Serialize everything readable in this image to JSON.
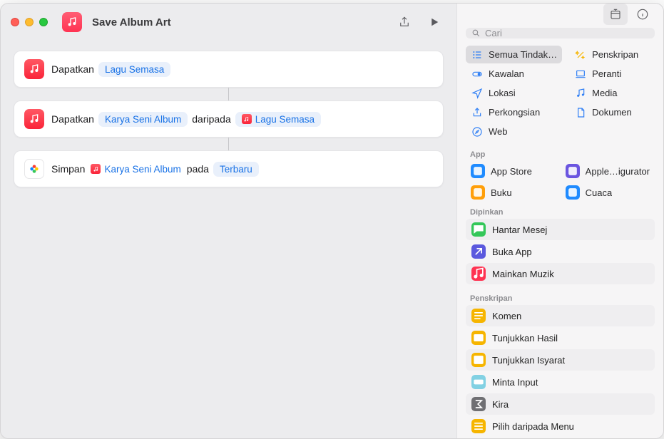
{
  "window_title": "Save Album Art",
  "search_placeholder": "Cari",
  "actions": [
    {
      "icon": "music",
      "parts": [
        {
          "type": "text",
          "value": "Dapatkan"
        },
        {
          "type": "token",
          "value": "Lagu Semasa"
        }
      ]
    },
    {
      "icon": "music",
      "parts": [
        {
          "type": "text",
          "value": "Dapatkan"
        },
        {
          "type": "token",
          "value": "Karya Seni Album"
        },
        {
          "type": "text",
          "value": "daripada"
        },
        {
          "type": "token",
          "icon": "music",
          "value": "Lagu Semasa"
        }
      ]
    },
    {
      "icon": "photos",
      "parts": [
        {
          "type": "text",
          "value": "Simpan"
        },
        {
          "type": "plain",
          "icon": "music",
          "value": "Karya Seni Album"
        },
        {
          "type": "text",
          "value": "pada"
        },
        {
          "type": "token",
          "value": "Terbaru"
        }
      ]
    }
  ],
  "categories": [
    {
      "label": "Semua Tindak…",
      "icon": "list",
      "color": "#2f7ff5",
      "selected": true
    },
    {
      "label": "Penskripan",
      "icon": "wand",
      "color": "#f6b500"
    },
    {
      "label": "Kawalan",
      "icon": "toggle",
      "color": "#2f7ff5"
    },
    {
      "label": "Peranti",
      "icon": "device",
      "color": "#2f7ff5"
    },
    {
      "label": "Lokasi",
      "icon": "location",
      "color": "#2f7ff5"
    },
    {
      "label": "Media",
      "icon": "note",
      "color": "#2f7ff5"
    },
    {
      "label": "Perkongsian",
      "icon": "share",
      "color": "#2f7ff5"
    },
    {
      "label": "Dokumen",
      "icon": "doc",
      "color": "#2f7ff5"
    },
    {
      "label": "Web",
      "icon": "safari",
      "color": "#2f7ff5"
    }
  ],
  "section_app_label": "App",
  "apps": [
    {
      "label": "App Store",
      "color": "#1f8bff"
    },
    {
      "label": "Apple…igurator",
      "color": "#6b55e0"
    },
    {
      "label": "Buku",
      "color": "#ff9f0a"
    },
    {
      "label": "Cuaca",
      "color": "#1f8bff"
    }
  ],
  "section_pinned_label": "Dipinkan",
  "pinned": [
    {
      "label": "Hantar Mesej",
      "color": "#34c759",
      "icon": "message"
    },
    {
      "label": "Buka App",
      "color": "#5b59de",
      "icon": "open"
    },
    {
      "label": "Mainkan Muzik",
      "color": "#ff3352",
      "icon": "music"
    }
  ],
  "section_script_label": "Penskripan",
  "scripting": [
    {
      "label": "Komen",
      "color": "#f6b500",
      "icon": "lines"
    },
    {
      "label": "Tunjukkan Hasil",
      "color": "#f6b500",
      "icon": "result"
    },
    {
      "label": "Tunjukkan Isyarat",
      "color": "#f6b500",
      "icon": "alert"
    },
    {
      "label": "Minta Input",
      "color": "#82d1e3",
      "icon": "input"
    },
    {
      "label": "Kira",
      "color": "#6f6f73",
      "icon": "sigma"
    },
    {
      "label": "Pilih daripada Menu",
      "color": "#f6b500",
      "icon": "menu"
    }
  ]
}
